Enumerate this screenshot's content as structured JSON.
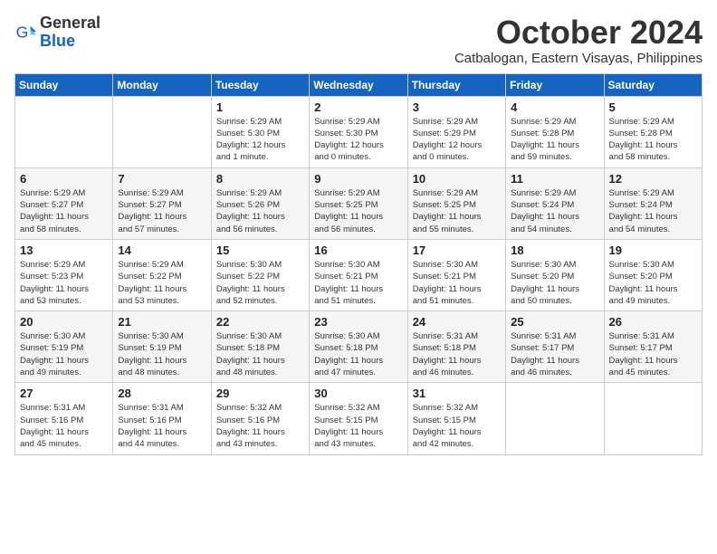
{
  "logo": {
    "text_general": "General",
    "text_blue": "Blue"
  },
  "title": "October 2024",
  "subtitle": "Catbalogan, Eastern Visayas, Philippines",
  "days_of_week": [
    "Sunday",
    "Monday",
    "Tuesday",
    "Wednesday",
    "Thursday",
    "Friday",
    "Saturday"
  ],
  "weeks": [
    [
      {
        "day": "",
        "info": ""
      },
      {
        "day": "",
        "info": ""
      },
      {
        "day": "1",
        "info": "Sunrise: 5:29 AM\nSunset: 5:30 PM\nDaylight: 12 hours\nand 1 minute."
      },
      {
        "day": "2",
        "info": "Sunrise: 5:29 AM\nSunset: 5:30 PM\nDaylight: 12 hours\nand 0 minutes."
      },
      {
        "day": "3",
        "info": "Sunrise: 5:29 AM\nSunset: 5:29 PM\nDaylight: 12 hours\nand 0 minutes."
      },
      {
        "day": "4",
        "info": "Sunrise: 5:29 AM\nSunset: 5:28 PM\nDaylight: 11 hours\nand 59 minutes."
      },
      {
        "day": "5",
        "info": "Sunrise: 5:29 AM\nSunset: 5:28 PM\nDaylight: 11 hours\nand 58 minutes."
      }
    ],
    [
      {
        "day": "6",
        "info": "Sunrise: 5:29 AM\nSunset: 5:27 PM\nDaylight: 11 hours\nand 58 minutes."
      },
      {
        "day": "7",
        "info": "Sunrise: 5:29 AM\nSunset: 5:27 PM\nDaylight: 11 hours\nand 57 minutes."
      },
      {
        "day": "8",
        "info": "Sunrise: 5:29 AM\nSunset: 5:26 PM\nDaylight: 11 hours\nand 56 minutes."
      },
      {
        "day": "9",
        "info": "Sunrise: 5:29 AM\nSunset: 5:25 PM\nDaylight: 11 hours\nand 56 minutes."
      },
      {
        "day": "10",
        "info": "Sunrise: 5:29 AM\nSunset: 5:25 PM\nDaylight: 11 hours\nand 55 minutes."
      },
      {
        "day": "11",
        "info": "Sunrise: 5:29 AM\nSunset: 5:24 PM\nDaylight: 11 hours\nand 54 minutes."
      },
      {
        "day": "12",
        "info": "Sunrise: 5:29 AM\nSunset: 5:24 PM\nDaylight: 11 hours\nand 54 minutes."
      }
    ],
    [
      {
        "day": "13",
        "info": "Sunrise: 5:29 AM\nSunset: 5:23 PM\nDaylight: 11 hours\nand 53 minutes."
      },
      {
        "day": "14",
        "info": "Sunrise: 5:29 AM\nSunset: 5:22 PM\nDaylight: 11 hours\nand 53 minutes."
      },
      {
        "day": "15",
        "info": "Sunrise: 5:30 AM\nSunset: 5:22 PM\nDaylight: 11 hours\nand 52 minutes."
      },
      {
        "day": "16",
        "info": "Sunrise: 5:30 AM\nSunset: 5:21 PM\nDaylight: 11 hours\nand 51 minutes."
      },
      {
        "day": "17",
        "info": "Sunrise: 5:30 AM\nSunset: 5:21 PM\nDaylight: 11 hours\nand 51 minutes."
      },
      {
        "day": "18",
        "info": "Sunrise: 5:30 AM\nSunset: 5:20 PM\nDaylight: 11 hours\nand 50 minutes."
      },
      {
        "day": "19",
        "info": "Sunrise: 5:30 AM\nSunset: 5:20 PM\nDaylight: 11 hours\nand 49 minutes."
      }
    ],
    [
      {
        "day": "20",
        "info": "Sunrise: 5:30 AM\nSunset: 5:19 PM\nDaylight: 11 hours\nand 49 minutes."
      },
      {
        "day": "21",
        "info": "Sunrise: 5:30 AM\nSunset: 5:19 PM\nDaylight: 11 hours\nand 48 minutes."
      },
      {
        "day": "22",
        "info": "Sunrise: 5:30 AM\nSunset: 5:18 PM\nDaylight: 11 hours\nand 48 minutes."
      },
      {
        "day": "23",
        "info": "Sunrise: 5:30 AM\nSunset: 5:18 PM\nDaylight: 11 hours\nand 47 minutes."
      },
      {
        "day": "24",
        "info": "Sunrise: 5:31 AM\nSunset: 5:18 PM\nDaylight: 11 hours\nand 46 minutes."
      },
      {
        "day": "25",
        "info": "Sunrise: 5:31 AM\nSunset: 5:17 PM\nDaylight: 11 hours\nand 46 minutes."
      },
      {
        "day": "26",
        "info": "Sunrise: 5:31 AM\nSunset: 5:17 PM\nDaylight: 11 hours\nand 45 minutes."
      }
    ],
    [
      {
        "day": "27",
        "info": "Sunrise: 5:31 AM\nSunset: 5:16 PM\nDaylight: 11 hours\nand 45 minutes."
      },
      {
        "day": "28",
        "info": "Sunrise: 5:31 AM\nSunset: 5:16 PM\nDaylight: 11 hours\nand 44 minutes."
      },
      {
        "day": "29",
        "info": "Sunrise: 5:32 AM\nSunset: 5:16 PM\nDaylight: 11 hours\nand 43 minutes."
      },
      {
        "day": "30",
        "info": "Sunrise: 5:32 AM\nSunset: 5:15 PM\nDaylight: 11 hours\nand 43 minutes."
      },
      {
        "day": "31",
        "info": "Sunrise: 5:32 AM\nSunset: 5:15 PM\nDaylight: 11 hours\nand 42 minutes."
      },
      {
        "day": "",
        "info": ""
      },
      {
        "day": "",
        "info": ""
      }
    ]
  ]
}
